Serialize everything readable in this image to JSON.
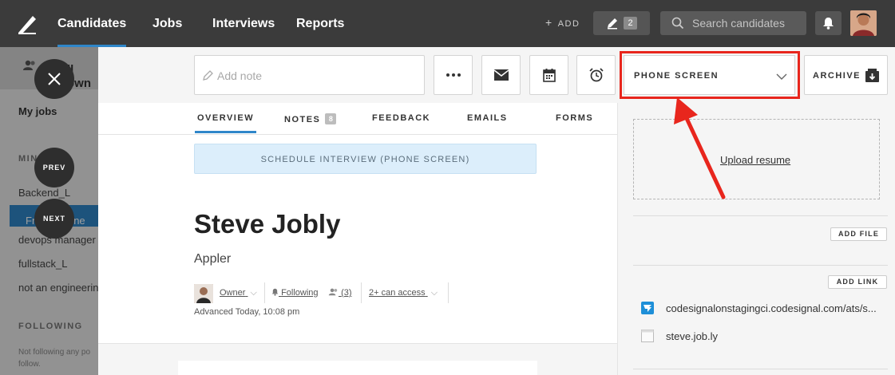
{
  "nav": {
    "items": [
      "Candidates",
      "Jobs",
      "Interviews",
      "Reports"
    ],
    "add_label": "ADD",
    "edit_count": "2",
    "search_placeholder": "Search candidates"
  },
  "sidebar": {
    "owner_partial": "ll own",
    "my_jobs": "My jobs",
    "section_partial": "MIN",
    "jobs": [
      "Backend_L",
      "Fron",
      "tengine",
      "devops manager",
      "fullstack_L",
      "not an engineerin"
    ],
    "following_header": "FOLLOWING",
    "following_note": "Not following any po follow."
  },
  "overlay": {
    "prev_label": "PREV",
    "next_label": "NEXT"
  },
  "toolbar": {
    "note_placeholder": "Add note",
    "stage": "PHONE SCREEN",
    "archive": "ARCHIVE"
  },
  "tabs": [
    {
      "label": "OVERVIEW",
      "active": true
    },
    {
      "label": "NOTES",
      "badge": "8"
    },
    {
      "label": "FEEDBACK"
    },
    {
      "label": "EMAILS"
    },
    {
      "label": "FORMS"
    }
  ],
  "banner": "SCHEDULE INTERVIEW (PHONE SCREEN)",
  "candidate": {
    "name": "Steve Jobly",
    "company": "Appler",
    "owner": "Owner",
    "following": "Following",
    "followers": "(3)",
    "access": "2+ can access",
    "advanced": "Advanced Today, 10:08 pm"
  },
  "right": {
    "upload": "Upload resume",
    "add_file": "ADD FILE",
    "add_link": "ADD LINK",
    "links": [
      "codesignalonstagingci.codesignal.com/ats/s...",
      "steve.job.ly"
    ]
  },
  "colors": {
    "accent": "#2f86c9",
    "highlight": "#e8261d",
    "topbar": "#3b3b3b"
  }
}
